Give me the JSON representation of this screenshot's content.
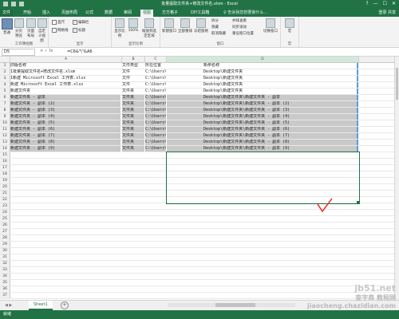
{
  "window": {
    "title": "批量提取文件夹+修改文件名.xlsm - Excel",
    "controls": [
      "?",
      "—",
      "☐",
      "✕"
    ]
  },
  "ribbon_tabs": [
    "文件",
    "开始",
    "插入",
    "页面布局",
    "公式",
    "数据",
    "审阅",
    "视图",
    "方方格子",
    "DIY工具箱"
  ],
  "active_tab": "视图",
  "tell_me": "♀ 告诉我您想要做什么…",
  "sign_in": "登录 共享",
  "ribbon": {
    "workbook_views": {
      "label": "工作簿视图",
      "buttons": [
        "普通",
        "分页预览",
        "页面布局",
        "自定义视图"
      ]
    },
    "show": {
      "label": "显示",
      "checks": [
        {
          "label": "直尺",
          "checked": false
        },
        {
          "label": "编辑栏",
          "checked": true
        },
        {
          "label": "网格线",
          "checked": false
        },
        {
          "label": "标题",
          "checked": true
        }
      ]
    },
    "zoom": {
      "label": "显示比例",
      "buttons": [
        "显示比例",
        "100%",
        "缩放到选定区域"
      ]
    },
    "window": {
      "label": "窗口",
      "buttons": [
        "新建窗口",
        "全部重排",
        "冻结窗格"
      ],
      "small": [
        "拆分",
        "隐藏",
        "取消隐藏",
        "并排查看",
        "同步滚动",
        "重设窗口位置"
      ],
      "switch": "切换窗口"
    },
    "macros": {
      "label": "宏",
      "button": "宏"
    }
  },
  "formula_bar": {
    "name_box": "D5",
    "icons": "× ✓ fx",
    "formula": "=C6&\"\\\"&A6"
  },
  "columns": [
    "A",
    "B",
    "C",
    "D"
  ],
  "selected_column": "D",
  "rows": [
    {
      "n": "1",
      "A": "旧版名称",
      "B": "文件类型",
      "C": "所在位置",
      "D": "新命名称",
      "range": false,
      "blue": true
    },
    {
      "n": "2",
      "A": "1批量提取文件名+修改文件名.xlsm",
      "B": "文件",
      "C": "C:\\Users\\",
      "D": "Desktop\\新建文件夹",
      "range": false,
      "blue": true
    },
    {
      "n": "3",
      "A": "1新建 Microsoft Excel 工作表.xlsx",
      "B": "文件",
      "C": "C:\\Users\\",
      "D": "Desktop\\新建文件夹",
      "range": false,
      "blue": true
    },
    {
      "n": "4",
      "A": "新建 Microsoft Excel 工作表.xlsx",
      "B": "文件",
      "C": "C:\\Users\\",
      "D": "Desktop\\新建文件夹",
      "range": false,
      "blue": true
    },
    {
      "n": "5",
      "A": "新建文件夹",
      "B": "文件夹",
      "C": "C:\\Users\\",
      "D": "Desktop\\新建文件夹",
      "range": false,
      "blue": true
    },
    {
      "n": "6",
      "A": "新建文件夹 - 副本",
      "B": "文件夹",
      "C": "C:\\Users\\",
      "D": "Desktop\\新建文件夹\\新建文件夹 - 副本",
      "range": true,
      "blue": true
    },
    {
      "n": "7",
      "A": "新建文件夹 - 副本 (2)",
      "B": "文件夹",
      "C": "C:\\Users\\",
      "D": "Desktop\\新建文件夹\\新建文件夹 - 副本 (2)",
      "range": true,
      "blue": true
    },
    {
      "n": "8",
      "A": "新建文件夹 - 副本 (3)",
      "B": "文件夹",
      "C": "C:\\Users\\",
      "D": "Desktop\\新建文件夹\\新建文件夹 - 副本 (3)",
      "range": true,
      "blue": true
    },
    {
      "n": "9",
      "A": "新建文件夹 - 副本 (4)",
      "B": "文件夹",
      "C": "C:\\Users\\",
      "D": "Desktop\\新建文件夹\\新建文件夹 - 副本 (4)",
      "range": true,
      "blue": true
    },
    {
      "n": "10",
      "A": "新建文件夹 - 副本 (5)",
      "B": "文件夹",
      "C": "C:\\Users\\",
      "D": "Desktop\\新建文件夹\\新建文件夹 - 副本 (5)",
      "range": true,
      "blue": true
    },
    {
      "n": "11",
      "A": "新建文件夹 - 副本 (6)",
      "B": "文件夹",
      "C": "C:\\Users\\",
      "D": "Desktop\\新建文件夹\\新建文件夹 - 副本 (6)",
      "range": true,
      "blue": true
    },
    {
      "n": "12",
      "A": "新建文件夹 - 副本 (7)",
      "B": "文件夹",
      "C": "C:\\Users\\",
      "D": "Desktop\\新建文件夹\\新建文件夹 - 副本 (7)",
      "range": true,
      "blue": true
    },
    {
      "n": "13",
      "A": "新建文件夹 - 副本 (8)",
      "B": "文件夹",
      "C": "C:\\Users\\",
      "D": "Desktop\\新建文件夹\\新建文件夹 - 副本 (8)",
      "range": true,
      "blue": true
    },
    {
      "n": "14",
      "A": "新建文件夹 - 副本 (9)",
      "B": "文件夹",
      "C": "C:\\Users\\",
      "D": "Desktop\\新建文件夹\\新建文件夹 - 副本 (9)",
      "range": true,
      "blue": true
    },
    {
      "n": "15",
      "A": "",
      "B": "",
      "C": "",
      "D": "",
      "range": false,
      "blue": false
    },
    {
      "n": "16",
      "A": "",
      "B": "",
      "C": "",
      "D": "",
      "range": false,
      "blue": false
    },
    {
      "n": "17",
      "A": "",
      "B": "",
      "C": "",
      "D": "",
      "range": false,
      "blue": false
    },
    {
      "n": "18",
      "A": "",
      "B": "",
      "C": "",
      "D": "",
      "range": false,
      "blue": false
    },
    {
      "n": "19",
      "A": "",
      "B": "",
      "C": "",
      "D": "",
      "range": false,
      "blue": false
    },
    {
      "n": "20",
      "A": "",
      "B": "",
      "C": "",
      "D": "",
      "range": false,
      "blue": false
    },
    {
      "n": "21",
      "A": "",
      "B": "",
      "C": "",
      "D": "",
      "range": false,
      "blue": false
    },
    {
      "n": "22",
      "A": "",
      "B": "",
      "C": "",
      "D": "",
      "range": false,
      "blue": false
    },
    {
      "n": "23",
      "A": "",
      "B": "",
      "C": "",
      "D": "",
      "range": false,
      "blue": false
    },
    {
      "n": "24",
      "A": "",
      "B": "",
      "C": "",
      "D": "",
      "range": false,
      "blue": false
    },
    {
      "n": "25",
      "A": "",
      "B": "",
      "C": "",
      "D": "",
      "range": false,
      "blue": false
    },
    {
      "n": "26",
      "A": "",
      "B": "",
      "C": "",
      "D": "",
      "range": false,
      "blue": false
    },
    {
      "n": "27",
      "A": "",
      "B": "",
      "C": "",
      "D": "",
      "range": false,
      "blue": false
    },
    {
      "n": "28",
      "A": "",
      "B": "",
      "C": "",
      "D": "",
      "range": false,
      "blue": false
    },
    {
      "n": "29",
      "A": "",
      "B": "",
      "C": "",
      "D": "",
      "range": false,
      "blue": false
    },
    {
      "n": "30",
      "A": "",
      "B": "",
      "C": "",
      "D": "",
      "range": false,
      "blue": false
    },
    {
      "n": "31",
      "A": "",
      "B": "",
      "C": "",
      "D": "",
      "range": false,
      "blue": false
    },
    {
      "n": "32",
      "A": "",
      "B": "",
      "C": "",
      "D": "",
      "range": false,
      "blue": false
    },
    {
      "n": "33",
      "A": "",
      "B": "",
      "C": "",
      "D": "",
      "range": false,
      "blue": false
    },
    {
      "n": "34",
      "A": "",
      "B": "",
      "C": "",
      "D": "",
      "range": false,
      "blue": false
    },
    {
      "n": "35",
      "A": "",
      "B": "",
      "C": "",
      "D": "",
      "range": false,
      "blue": false
    },
    {
      "n": "36",
      "A": "",
      "B": "",
      "C": "",
      "D": "",
      "range": false,
      "blue": false
    },
    {
      "n": "37",
      "A": "",
      "B": "",
      "C": "",
      "D": "",
      "range": false,
      "blue": false
    }
  ],
  "sheet": {
    "tab": "Sheet1",
    "add": "+",
    "nav": "◀ ▶"
  },
  "status": {
    "ready": "就绪"
  },
  "colors": {
    "accent": "#217346",
    "selection_blue": "#5b9bd5",
    "range_gray": "#c9c9c9",
    "check_red": "#e53935"
  },
  "watermark": {
    "line1": "jb51.net",
    "line2": "查字典 教程网",
    "line3": "jiaocheng.chazidian.com"
  }
}
